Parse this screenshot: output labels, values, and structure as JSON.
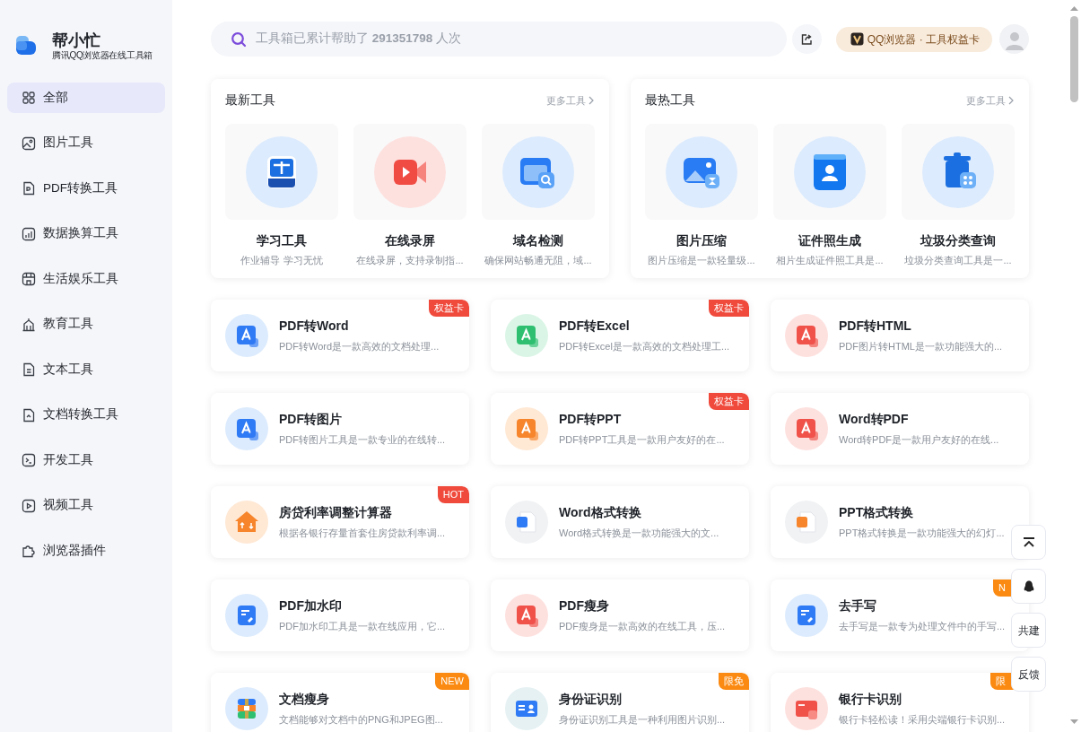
{
  "brand": {
    "name": "帮小忙",
    "subtitle": "腾讯QQ浏览器在线工具箱"
  },
  "sidebar": {
    "items": [
      {
        "label": "全部",
        "selected": true
      },
      {
        "label": "图片工具",
        "selected": false
      },
      {
        "label": "PDF转换工具",
        "selected": false
      },
      {
        "label": "数据换算工具",
        "selected": false
      },
      {
        "label": "生活娱乐工具",
        "selected": false
      },
      {
        "label": "教育工具",
        "selected": false
      },
      {
        "label": "文本工具",
        "selected": false
      },
      {
        "label": "文档转换工具",
        "selected": false
      },
      {
        "label": "开发工具",
        "selected": false
      },
      {
        "label": "视频工具",
        "selected": false
      },
      {
        "label": "浏览器插件",
        "selected": false
      }
    ]
  },
  "search": {
    "text": "工具箱已累计帮助了 **291351798** 人次"
  },
  "header": {
    "membership": "QQ浏览器 · 工具权益卡"
  },
  "panels": [
    {
      "title": "最新工具",
      "more": "更多工具",
      "tools": [
        {
          "name": "学习工具",
          "description": "作业辅导 学习无忧"
        },
        {
          "name": "在线录屏",
          "description": "在线录屏，支持录制指..."
        },
        {
          "name": "域名检测",
          "description": "确保网站畅通无阻，域..."
        }
      ]
    },
    {
      "title": "最热工具",
      "more": "更多工具",
      "tools": [
        {
          "name": "图片压缩",
          "description": "图片压缩是一款轻量级..."
        },
        {
          "name": "证件照生成",
          "description": "相片生成证件照工具是..."
        },
        {
          "name": "垃圾分类查询",
          "description": "垃圾分类查询工具是一..."
        }
      ]
    }
  ],
  "tools": [
    {
      "name": "PDF转Word",
      "description": "PDF转Word是一款高效的文档处理...",
      "badge": {
        "text": "权益卡",
        "kind": "card"
      }
    },
    {
      "name": "PDF转Excel",
      "description": "PDF转Excel是一款高效的文档处理工...",
      "badge": {
        "text": "权益卡",
        "kind": "card"
      }
    },
    {
      "name": "PDF转HTML",
      "description": "PDF图片转HTML是一款功能强大的..."
    },
    {
      "name": "PDF转图片",
      "description": "PDF转图片工具是一款专业的在线转..."
    },
    {
      "name": "PDF转PPT",
      "description": "PDF转PPT工具是一款用户友好的在...",
      "badge": {
        "text": "权益卡",
        "kind": "card"
      }
    },
    {
      "name": "Word转PDF",
      "description": "Word转PDF是一款用户友好的在线..."
    },
    {
      "name": "房贷利率调整计算器",
      "description": "根据各银行存量首套住房贷款利率调...",
      "badge": {
        "text": "HOT",
        "kind": "hot"
      }
    },
    {
      "name": "Word格式转换",
      "description": "Word格式转换是一款功能强大的文..."
    },
    {
      "name": "PPT格式转换",
      "description": "PPT格式转换是一款功能强大的幻灯..."
    },
    {
      "name": "PDF加水印",
      "description": "PDF加水印工具是一款在线应用，它..."
    },
    {
      "name": "PDF瘦身",
      "description": "PDF瘦身是一款高效的在线工具，压..."
    },
    {
      "name": "去手写",
      "description": "去手写是一款专为处理文件中的手写...",
      "badge": {
        "text": "N",
        "kind": "new"
      }
    },
    {
      "name": "文档瘦身",
      "description": "文档能够对文档中的PNG和JPEG图...",
      "badge": {
        "text": "NEW",
        "kind": "new"
      }
    },
    {
      "name": "身份证识别",
      "description": "身份证识别工具是一种利用图片识别...",
      "badge": {
        "text": "限免",
        "kind": "free"
      }
    },
    {
      "name": "银行卡识别",
      "description": "银行卡轻松读！采用尖端银行卡识别...",
      "badge": {
        "text": "限",
        "kind": "free"
      }
    }
  ],
  "float_buttons": [
    {
      "kind": "back-to-top"
    },
    {
      "kind": "chat"
    },
    {
      "kind": "text",
      "label": "共建"
    },
    {
      "kind": "text",
      "label": "反馈"
    }
  ]
}
